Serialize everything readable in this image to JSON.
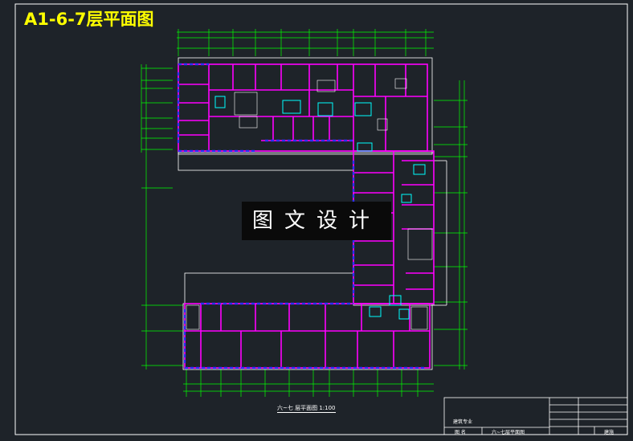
{
  "drawing": {
    "title": "A1-6-7层平面图",
    "watermark": "图文设计",
    "caption": "六~七 层平面图 1:100",
    "colors": {
      "background": "#1e2329",
      "walls": "#ff00ff",
      "dimension_lines": "#00ff00",
      "doors": "#0000ff",
      "fixtures": "#00ffff",
      "title": "#ffff00",
      "border": "#ffffff"
    }
  },
  "title_block": {
    "label_left": "图 名",
    "label_top": "建筑专业",
    "sheet_name": "六~七层平面图",
    "sheet_code": "建施"
  }
}
